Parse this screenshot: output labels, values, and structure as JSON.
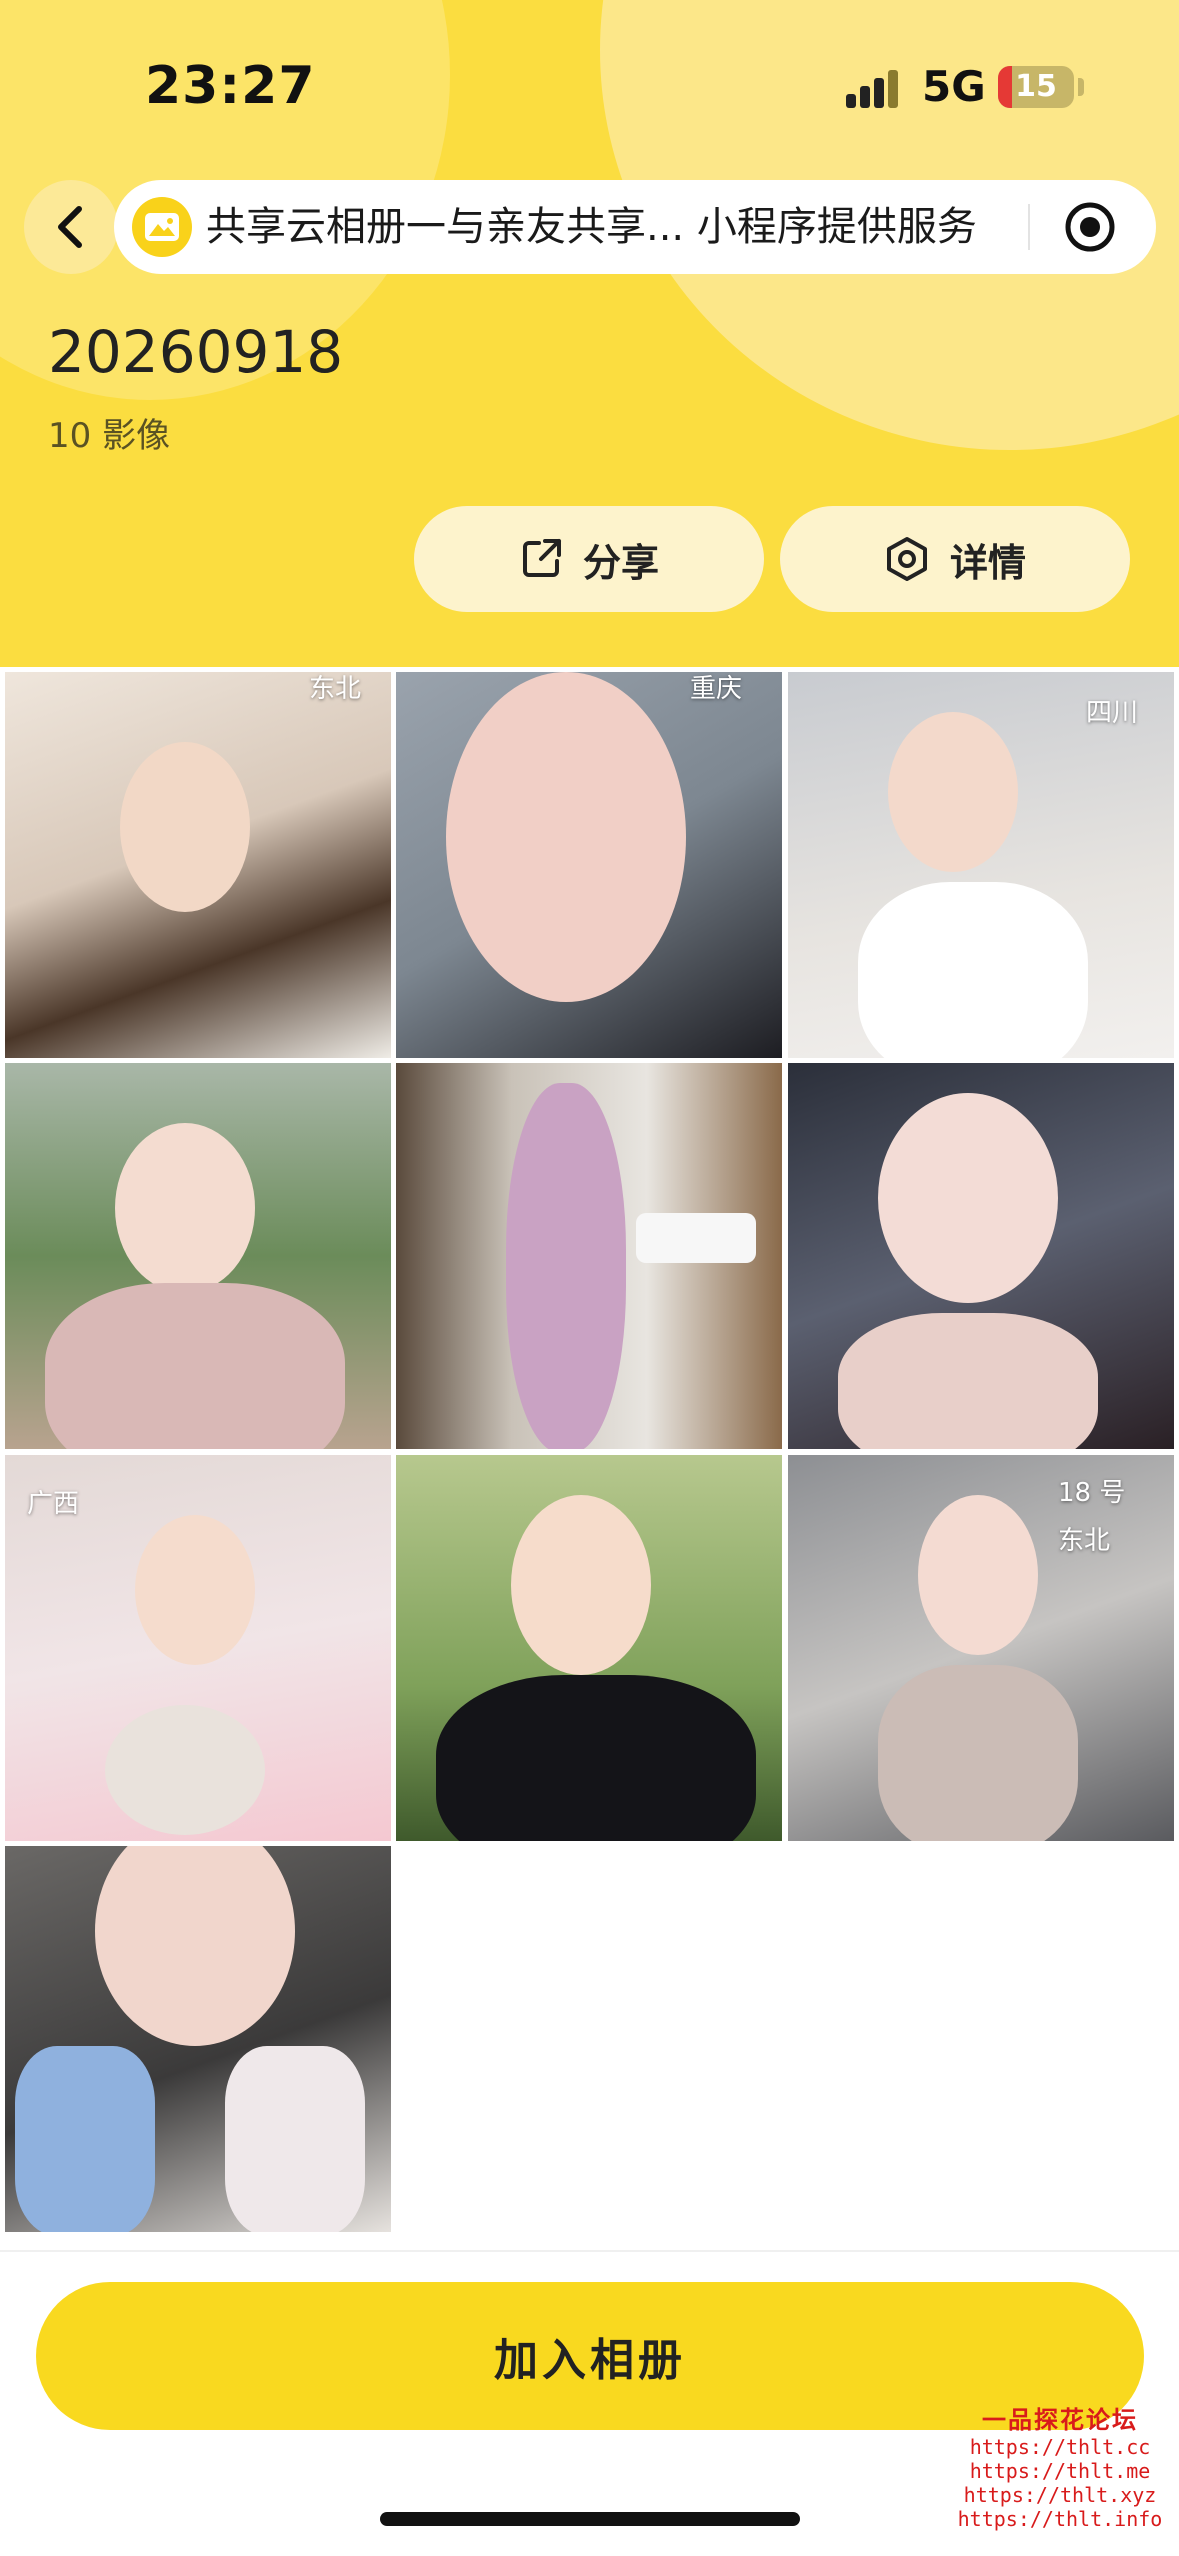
{
  "status_bar": {
    "time": "23:27",
    "network": "5G",
    "battery_level": 15
  },
  "nav": {
    "title": "共享云相册一与亲友共享... 小程序提供服务"
  },
  "album": {
    "title": "20260918",
    "count": "10 影像"
  },
  "actions": {
    "share_label": "分享",
    "detail_label": "详情"
  },
  "photos": [
    {
      "tag": "东北"
    },
    {
      "tag": "重庆"
    },
    {
      "tag": "四川"
    },
    {
      "tag": ""
    },
    {
      "tag": ""
    },
    {
      "tag": ""
    },
    {
      "tag": "广西"
    },
    {
      "tag": ""
    },
    {
      "tag": "18 号 东北"
    },
    {
      "tag": ""
    }
  ],
  "footer": {
    "join_label": "加入相册"
  },
  "watermark": {
    "title": "一品探花论坛",
    "urls": [
      "https://thlt.cc",
      "https://thlt.me",
      "https://thlt.xyz",
      "https://thlt.info"
    ]
  },
  "colors": {
    "header": "#FBDD40",
    "accent": "#F9D91F"
  }
}
